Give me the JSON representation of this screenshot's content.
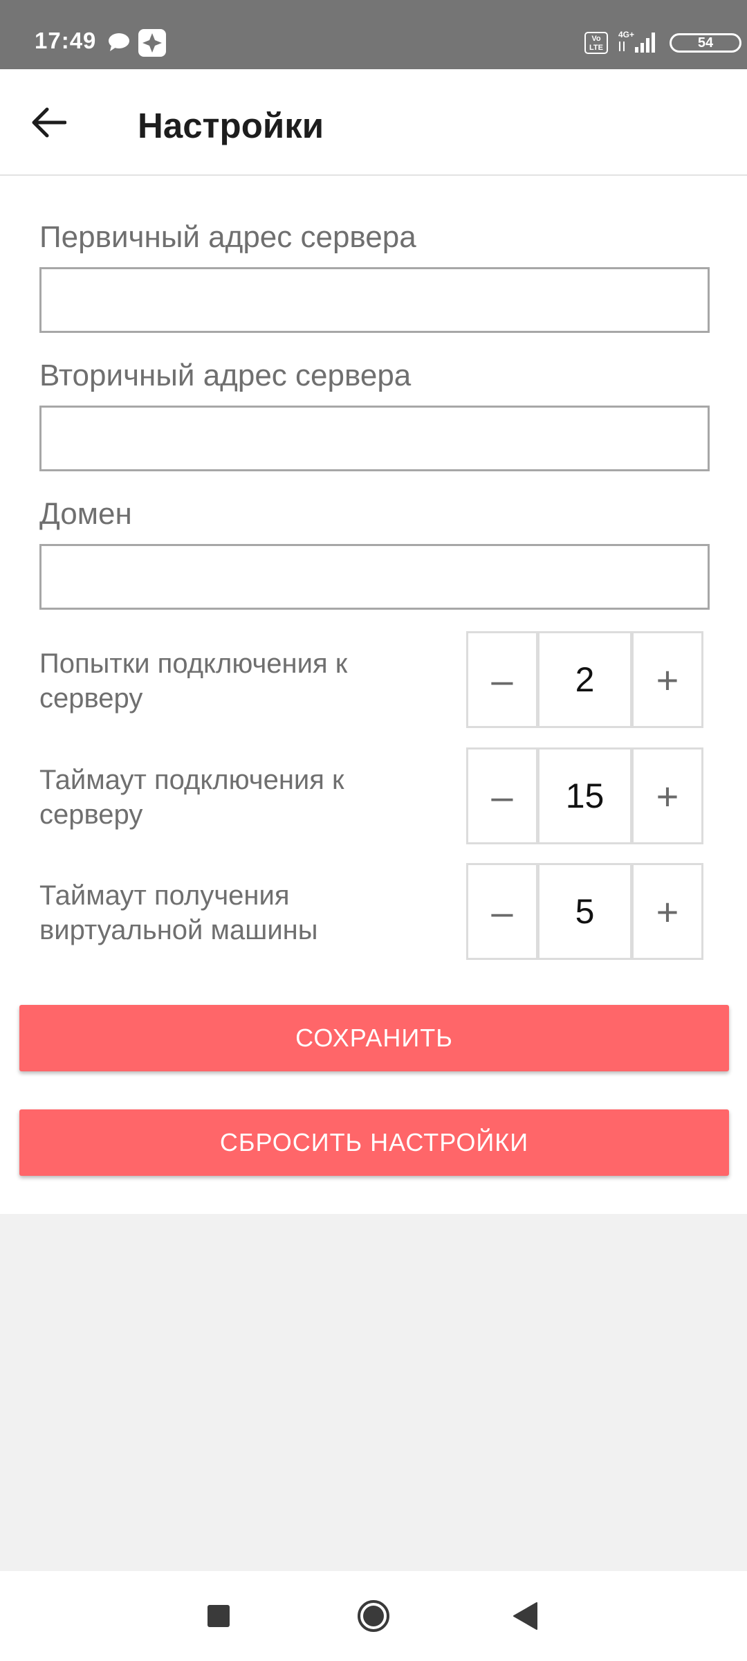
{
  "status_bar": {
    "time": "17:49",
    "network": "4G+",
    "volte": "Vo LTE",
    "battery": "54",
    "icons": [
      "chat-icon",
      "app-notification-icon",
      "volte-icon",
      "signal-icon",
      "battery-icon"
    ]
  },
  "app_bar": {
    "title": "Настройки",
    "back_icon": "arrow-left-icon"
  },
  "form": {
    "primary_server": {
      "label": "Первичный адрес сервера",
      "value": "",
      "placeholder": ""
    },
    "secondary_server": {
      "label": "Вторичный адрес сервера",
      "value": "",
      "placeholder": ""
    },
    "domain": {
      "label": "Домен",
      "value": "",
      "placeholder": ""
    },
    "steppers": [
      {
        "label": "Попытки подключения к серверу",
        "value": "2",
        "minus": "–",
        "plus": "+"
      },
      {
        "label": "Таймаут подключения к серверу",
        "value": "15",
        "minus": "–",
        "plus": "+"
      },
      {
        "label": "Таймаут получения виртуальной машины",
        "value": "5",
        "minus": "–",
        "plus": "+"
      }
    ]
  },
  "buttons": {
    "save": "СОХРАНИТЬ",
    "reset": "СБРОСИТЬ НАСТРОЙКИ"
  },
  "colors": {
    "accent": "#ff6669",
    "status_bar": "#757575",
    "background": "#f1f1f1"
  },
  "nav_bar": {
    "icons": [
      "recents-square-icon",
      "home-circle-icon",
      "back-triangle-icon"
    ]
  }
}
